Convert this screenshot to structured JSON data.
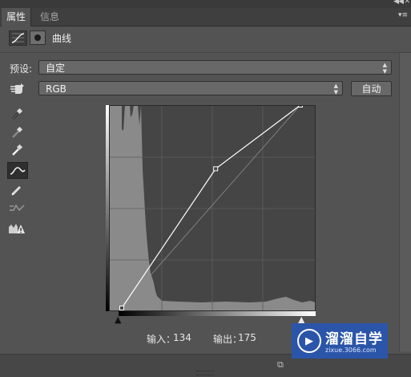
{
  "tabs": [
    {
      "label": "属性",
      "active": true
    },
    {
      "label": "信息",
      "active": false
    }
  ],
  "header": {
    "title": "曲线"
  },
  "preset": {
    "label": "预设:",
    "value": "自定"
  },
  "channel": {
    "value": "RGB"
  },
  "auto_button": "自动",
  "readout": {
    "input_label": "输入：",
    "input_value": "134",
    "output_label": "输出：",
    "output_value": "175"
  },
  "curve": {
    "points": [
      [
        0,
        0
      ],
      [
        134,
        175
      ],
      [
        255,
        255
      ]
    ]
  },
  "icons": {
    "header": [
      "curves-adjustment-icon",
      "mask-icon"
    ],
    "tools": [
      "hand-target-icon",
      "black-eyedropper-icon",
      "gray-eyedropper-icon",
      "white-eyedropper-icon",
      "curve-edit-icon",
      "pencil-icon",
      "smooth-icon",
      "clipping-warning-icon"
    ]
  },
  "watermark": {
    "title": "溜溜自学",
    "url": "zixue.3066.com"
  },
  "colors": {
    "panel": "#535353",
    "graph_bg": "#454545",
    "histogram": "#8a8a8a",
    "watermark": "#2b55a9"
  }
}
